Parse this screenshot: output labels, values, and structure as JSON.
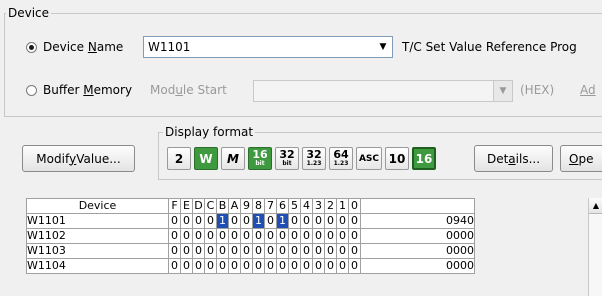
{
  "device_group": {
    "title": "Device",
    "device_name_label_pre": "Device ",
    "device_name_label_key": "N",
    "device_name_label_post": "ame",
    "device_name_value": "W1101",
    "tc_ref_label": "T/C Set Value Reference Prog",
    "buffer_memory_label_pre": "Buffer ",
    "buffer_memory_label_key": "M",
    "buffer_memory_label_post": "emory",
    "module_start_label_pre": "Mod",
    "module_start_label_key": "u",
    "module_start_label_post": "le Start",
    "hex_label": "(HEX)",
    "addr_label": "Ad",
    "selected_option": "device_name"
  },
  "modify_button": {
    "pre": "Modif",
    "key": "y",
    "post": " Value..."
  },
  "display_format": {
    "title": "Display format",
    "buttons": [
      {
        "label": "2",
        "name": "binary-format-button",
        "selected": false
      },
      {
        "label": "W",
        "name": "word-format-button",
        "selected": false,
        "style": "green"
      },
      {
        "label": "M",
        "name": "double-word-format-button",
        "selected": false
      },
      {
        "top": "16",
        "bottom": "bit",
        "name": "16bit-format-button",
        "style": "green",
        "selected": false
      },
      {
        "top": "32",
        "bottom": "bit",
        "name": "32bit-format-button",
        "selected": false
      },
      {
        "top": "32",
        "bottom": "1.23",
        "name": "32bit-real-format-button",
        "selected": false
      },
      {
        "top": "64",
        "bottom": "1.23",
        "name": "64bit-real-format-button",
        "selected": false
      },
      {
        "label": "ASC",
        "name": "ascii-format-button",
        "selected": false
      },
      {
        "label": "10",
        "name": "decimal-format-button",
        "selected": false
      },
      {
        "label": "16",
        "name": "hex-format-button",
        "selected": true
      }
    ],
    "details_pre": "Det",
    "details_key": "a",
    "details_post": "ils...",
    "open_pre": "",
    "open_key": "O",
    "open_post": "pe"
  },
  "table": {
    "headers": {
      "device": "Device",
      "bits": [
        "F",
        "E",
        "D",
        "C",
        "B",
        "A",
        "9",
        "8",
        "7",
        "6",
        "5",
        "4",
        "3",
        "2",
        "1",
        "0"
      ],
      "value": ""
    },
    "rows": [
      {
        "device": "W1101",
        "bits": [
          "0",
          "0",
          "0",
          "0",
          "1",
          "0",
          "0",
          "1",
          "0",
          "1",
          "0",
          "0",
          "0",
          "0",
          "0",
          "0"
        ],
        "value": "0940"
      },
      {
        "device": "W1102",
        "bits": [
          "0",
          "0",
          "0",
          "0",
          "0",
          "0",
          "0",
          "0",
          "0",
          "0",
          "0",
          "0",
          "0",
          "0",
          "0",
          "0"
        ],
        "value": "0000"
      },
      {
        "device": "W1103",
        "bits": [
          "0",
          "0",
          "0",
          "0",
          "0",
          "0",
          "0",
          "0",
          "0",
          "0",
          "0",
          "0",
          "0",
          "0",
          "0",
          "0"
        ],
        "value": "0000"
      },
      {
        "device": "W1104",
        "bits": [
          "0",
          "0",
          "0",
          "0",
          "0",
          "0",
          "0",
          "0",
          "0",
          "0",
          "0",
          "0",
          "0",
          "0",
          "0",
          "0"
        ],
        "value": "0000"
      }
    ]
  },
  "colors": {
    "selected_bit": "#1f4eb4",
    "green_button": "#3f9a3f"
  }
}
